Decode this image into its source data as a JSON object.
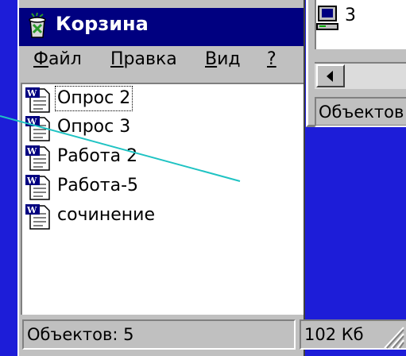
{
  "window": {
    "title": "Корзина"
  },
  "menu": [
    {
      "underline": "Ф",
      "rest": "айл"
    },
    {
      "underline": "П",
      "rest": "равка"
    },
    {
      "underline": "В",
      "rest": "ид"
    },
    {
      "underline": "?",
      "rest": ""
    }
  ],
  "files": [
    {
      "name": "Опрос 2",
      "icon": "word-document-icon"
    },
    {
      "name": "Опрос 3",
      "icon": "word-document-icon"
    },
    {
      "name": "Работа 2",
      "icon": "word-document-icon"
    },
    {
      "name": "Работа-5",
      "icon": "word-document-icon"
    },
    {
      "name": "сочинение",
      "icon": "word-document-icon"
    }
  ],
  "status": {
    "objects": "Объектов: 5",
    "size": "102 Кб"
  },
  "back_window": {
    "item_label": "3",
    "item_icon": "computer-icon",
    "status": "Объектов"
  },
  "colors": {
    "desktop": "#1d1dd8",
    "titlebar": "#000080",
    "window_face": "#c0c0c0",
    "pointer_line": "#1fc3c3"
  }
}
